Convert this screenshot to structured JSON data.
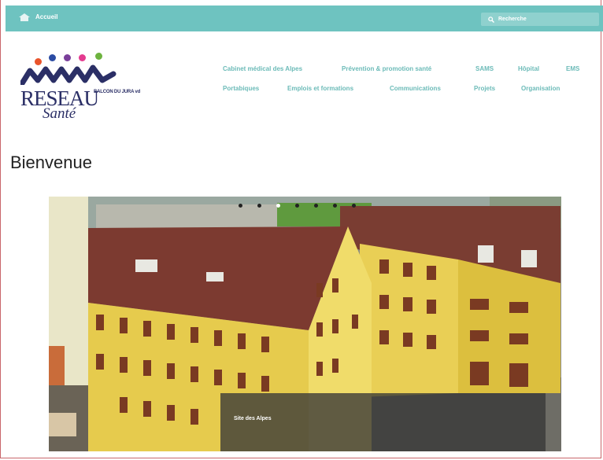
{
  "topbar": {
    "home_label": "Accueil",
    "search_placeholder": "Recherche"
  },
  "logo": {
    "line1": "RESEAU",
    "line2": "BALCON DU JURA vd",
    "line3": "Santé",
    "dot_colors": [
      "#e9542b",
      "#2b4ba3",
      "#7a3f9a",
      "#e43b8f",
      "#6db33f"
    ]
  },
  "nav": {
    "row1": [
      "Cabinet médical des Alpes",
      "Prévention & promotion santé",
      "SAMS",
      "Hôpital",
      "EMS"
    ],
    "row2": [
      "Portabiques",
      "Emplois et formations",
      "Communications",
      "Projets",
      "Organisation"
    ]
  },
  "page": {
    "title": "Bienvenue"
  },
  "slider": {
    "caption": "Site des Alpes",
    "slide_count": 7,
    "active_slide": 2
  },
  "colors": {
    "topbar": "#6ec3c0",
    "nav_text": "#6cbbb8",
    "logo_text": "#2b2f66"
  }
}
